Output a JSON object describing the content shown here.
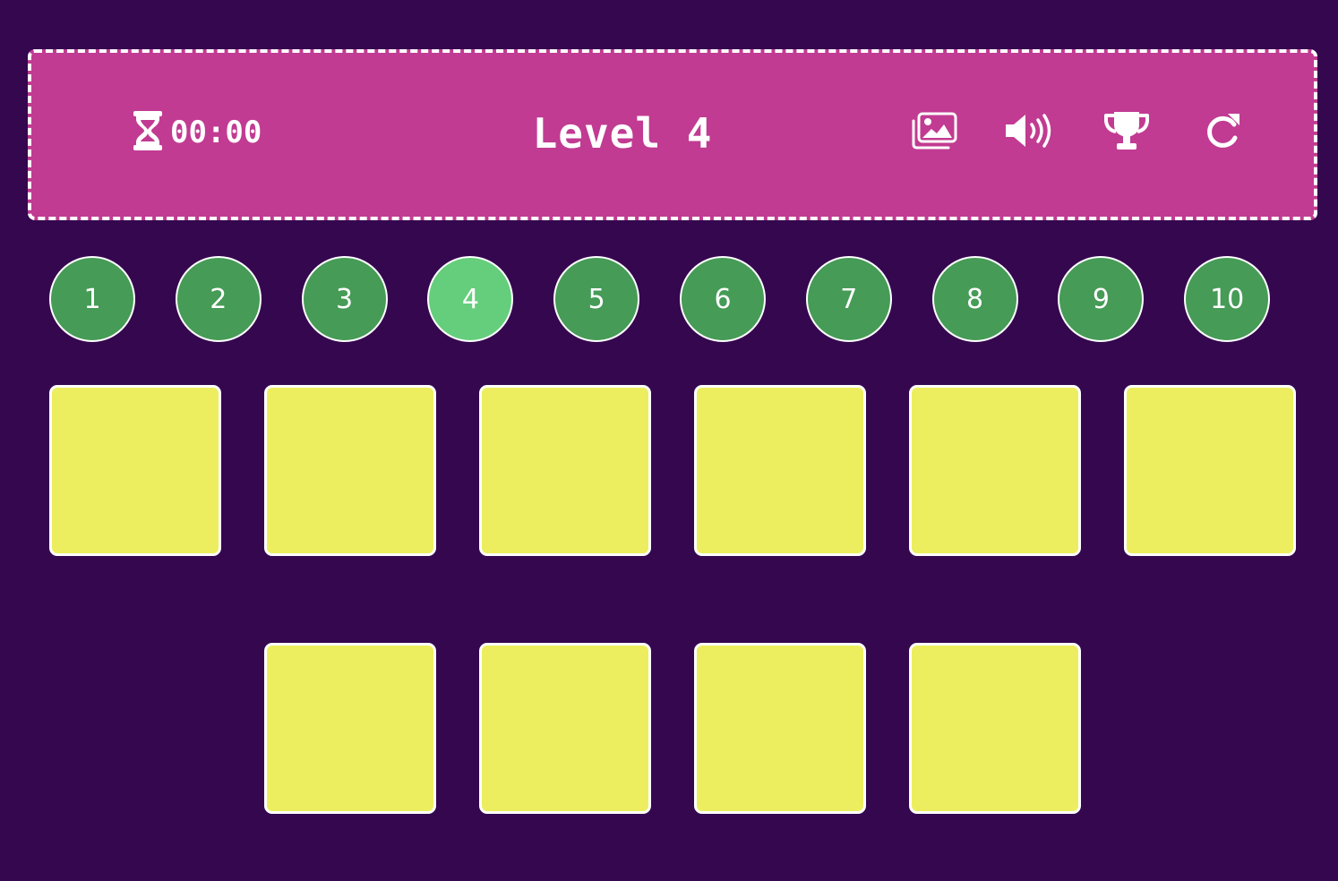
{
  "header": {
    "timer": "00:00",
    "level_title": "Level 4",
    "icons": {
      "timer": "hourglass-icon",
      "image": "image-icon",
      "sound": "volume-icon",
      "trophy": "trophy-icon",
      "restart": "restart-icon"
    }
  },
  "levels": {
    "items": [
      "1",
      "2",
      "3",
      "4",
      "5",
      "6",
      "7",
      "8",
      "9",
      "10"
    ],
    "active": "4"
  },
  "board": {
    "card_count": 10,
    "card_state": "face-down"
  },
  "colors": {
    "background": "#34074f",
    "header": "#c13b92",
    "level_button": "#469b57",
    "level_button_active": "#64ce7c",
    "card": "#ecee5f"
  }
}
